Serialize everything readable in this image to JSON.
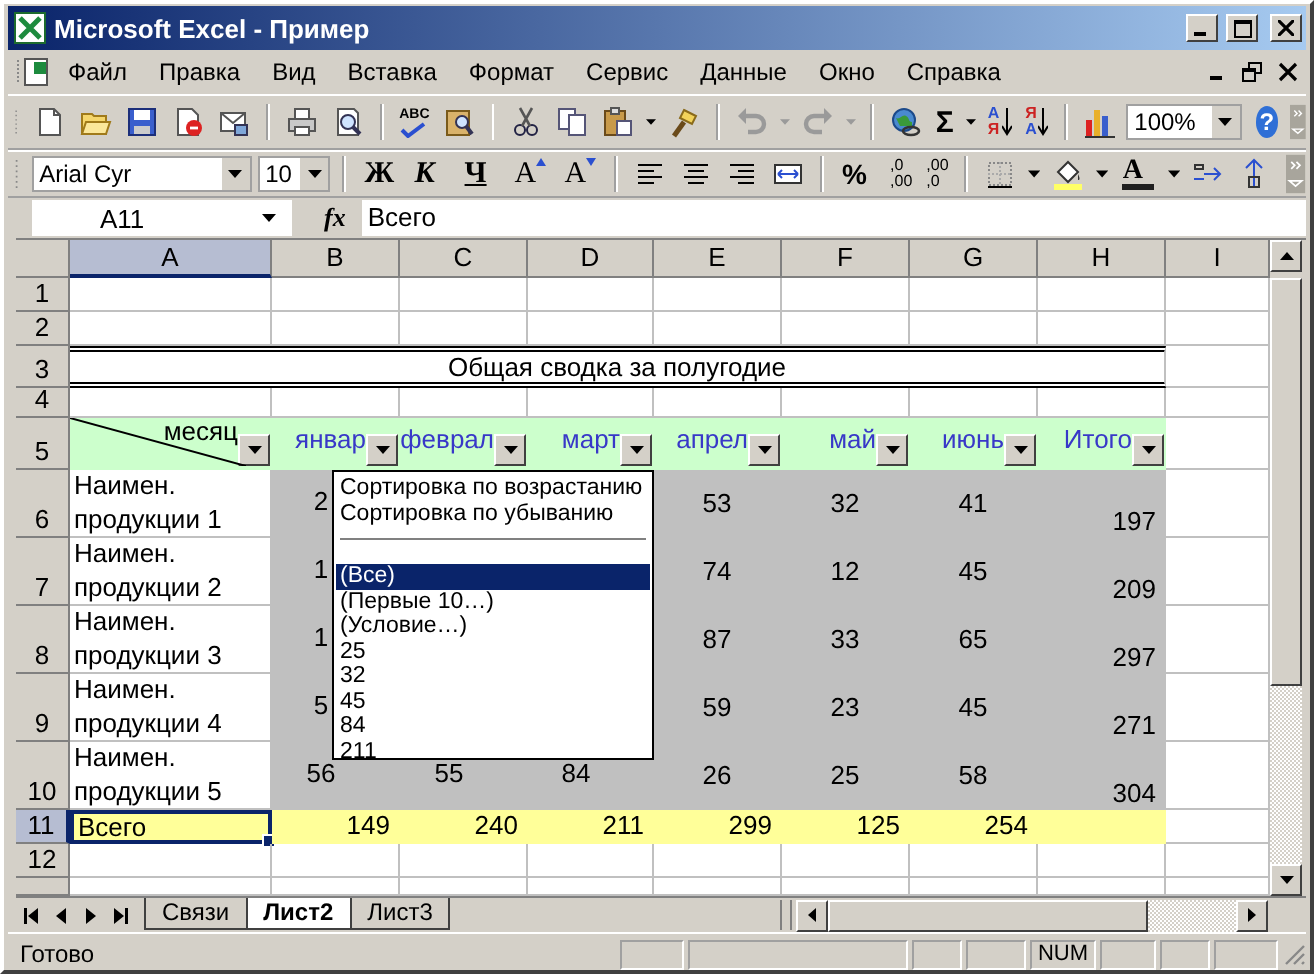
{
  "window": {
    "title": "Microsoft Excel - Пример"
  },
  "menu": [
    "Файл",
    "Правка",
    "Вид",
    "Вставка",
    "Формат",
    "Сервис",
    "Данные",
    "Окно",
    "Справка"
  ],
  "standard_toolbar": {
    "spelling": "ABC",
    "sum": "Σ",
    "sort_ascending": [
      "А",
      "Я"
    ],
    "sort_descending": [
      "Я",
      "А"
    ],
    "zoom": "100%",
    "help": "?"
  },
  "formatting_toolbar": {
    "font": "Arial Cyr",
    "size": "10",
    "bold": "Ж",
    "italic": "К",
    "underline": "Ч",
    "grow_font": "A",
    "shrink_font": "A",
    "percent": "%",
    "increase_decimal": [
      ",0",
      ",00"
    ],
    "decrease_decimal": [
      ",00",
      ",0"
    ],
    "font_color": "A"
  },
  "formula_bar": {
    "cell": "A11",
    "fx": "fx",
    "value": "Всего"
  },
  "sheet": {
    "columns": [
      {
        "label": "A",
        "selected": true
      },
      {
        "label": "B",
        "selected": false
      },
      {
        "label": "C",
        "selected": false
      },
      {
        "label": "D",
        "selected": false
      },
      {
        "label": "E",
        "selected": false
      },
      {
        "label": "F",
        "selected": false
      },
      {
        "label": "G",
        "selected": false
      },
      {
        "label": "H",
        "selected": false
      },
      {
        "label": "I",
        "selected": false
      }
    ],
    "rows": [
      {
        "number": "1",
        "kind": "blank",
        "selected": false
      },
      {
        "number": "2",
        "kind": "blank",
        "selected": false
      },
      {
        "number": "3",
        "kind": "title",
        "selected": false,
        "text": "Общая сводка за полугодие"
      },
      {
        "number": "4",
        "kind": "blank",
        "selected": false
      },
      {
        "number": "5",
        "kind": "header",
        "selected": false,
        "corner": "месяц",
        "headers": [
          "январ",
          "феврал",
          "март",
          "апрел",
          "май",
          "июнь",
          "Итого"
        ]
      },
      {
        "number": "6",
        "kind": "data",
        "selected": false,
        "name": "Наимен. продукции 1",
        "cells": {
          "B": "2",
          "E": "53",
          "F": "32",
          "G": "41",
          "H": "197"
        }
      },
      {
        "number": "7",
        "kind": "data",
        "selected": false,
        "name": "Наимен. продукции 2",
        "cells": {
          "B": "1",
          "E": "74",
          "F": "12",
          "G": "45",
          "H": "209"
        }
      },
      {
        "number": "8",
        "kind": "data",
        "selected": false,
        "name": "Наимен. продукции 3",
        "cells": {
          "B": "1",
          "E": "87",
          "F": "33",
          "G": "65",
          "H": "297"
        }
      },
      {
        "number": "9",
        "kind": "data",
        "selected": false,
        "name": "Наимен. продукции 4",
        "cells": {
          "B": "5",
          "E": "59",
          "F": "23",
          "G": "45",
          "H": "271"
        }
      },
      {
        "number": "10",
        "kind": "data",
        "selected": false,
        "name": "Наимен. продукции 5",
        "cells": {
          "B": "56",
          "C": "55",
          "D": "84",
          "E": "26",
          "F": "25",
          "G": "58",
          "H": "304"
        }
      },
      {
        "number": "11",
        "kind": "total",
        "selected": true,
        "label": "Всего",
        "cells": {
          "B": "149",
          "C": "240",
          "D": "211",
          "E": "299",
          "F": "125",
          "G": "254"
        }
      },
      {
        "number": "12",
        "kind": "blank",
        "selected": false
      }
    ]
  },
  "filter_list": {
    "sort_items": [
      "Сортировка по возрастанию",
      "Сортировка по убыванию"
    ],
    "items": [
      {
        "label": "(Все)",
        "selected": true
      },
      {
        "label": "(Первые 10…)",
        "selected": false
      },
      {
        "label": "(Условие…)",
        "selected": false
      },
      {
        "label": "25",
        "selected": false
      },
      {
        "label": "32",
        "selected": false
      },
      {
        "label": "45",
        "selected": false
      },
      {
        "label": "84",
        "selected": false
      },
      {
        "label": "211",
        "selected": false
      }
    ]
  },
  "sheet_tabs": [
    {
      "label": "Связи",
      "selected": false
    },
    {
      "label": "Лист2",
      "selected": true
    },
    {
      "label": "Лист3",
      "selected": false
    }
  ],
  "status_bar": {
    "text": "Готово",
    "num": "NUM"
  }
}
